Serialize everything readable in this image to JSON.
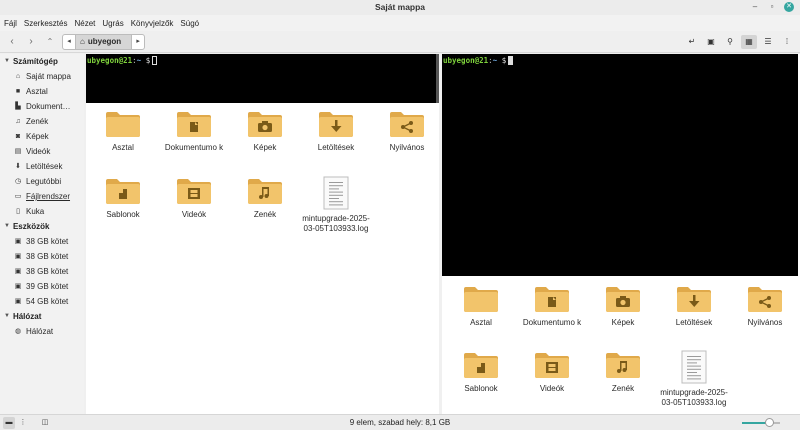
{
  "window": {
    "title": "Saját mappa"
  },
  "menu": [
    "Fájl",
    "Szerkesztés",
    "Nézet",
    "Ugrás",
    "Könyvjelzők",
    "Súgó"
  ],
  "pathbar": {
    "current": "ubyegon"
  },
  "sidebar": {
    "sections": [
      {
        "title": "Számítógép",
        "items": [
          {
            "label": "Saját mappa",
            "icon": "home-icon"
          },
          {
            "label": "Asztal",
            "icon": "desktop-icon"
          },
          {
            "label": "Dokument…",
            "icon": "document-icon"
          },
          {
            "label": "Zenék",
            "icon": "music-icon"
          },
          {
            "label": "Képek",
            "icon": "camera-icon"
          },
          {
            "label": "Videók",
            "icon": "film-icon"
          },
          {
            "label": "Letöltések",
            "icon": "download-icon"
          },
          {
            "label": "Legutóbbi",
            "icon": "clock-icon"
          },
          {
            "label": "Fájlrendszer",
            "icon": "drive-icon"
          },
          {
            "label": "Kuka",
            "icon": "trash-icon"
          }
        ]
      },
      {
        "title": "Eszközök",
        "items": [
          {
            "label": "38 GB kötet",
            "icon": "disk-icon"
          },
          {
            "label": "38 GB kötet",
            "icon": "disk-icon"
          },
          {
            "label": "38 GB kötet",
            "icon": "disk-icon"
          },
          {
            "label": "39 GB kötet",
            "icon": "disk-icon"
          },
          {
            "label": "54 GB kötet",
            "icon": "disk-icon"
          }
        ]
      },
      {
        "title": "Hálózat",
        "items": [
          {
            "label": "Hálózat",
            "icon": "network-icon"
          }
        ]
      }
    ]
  },
  "terminal": {
    "user": "ubyegon@21",
    "colon": ":",
    "path": "~",
    "prompt": "$"
  },
  "files": [
    {
      "name": "Asztal",
      "type": "folder",
      "emblem": ""
    },
    {
      "name": "Dokumentumo k",
      "type": "folder",
      "emblem": "document-icon"
    },
    {
      "name": "Képek",
      "type": "folder",
      "emblem": "camera-icon"
    },
    {
      "name": "Letöltések",
      "type": "folder",
      "emblem": "download-icon"
    },
    {
      "name": "Nyilvános",
      "type": "folder",
      "emblem": "share-icon"
    },
    {
      "name": "Sablonok",
      "type": "folder",
      "emblem": "template-icon"
    },
    {
      "name": "Videók",
      "type": "folder",
      "emblem": "film-icon"
    },
    {
      "name": "Zenék",
      "type": "folder",
      "emblem": "music-icon"
    },
    {
      "name": "mintupgrade-2025-03-05T103933.log",
      "type": "file",
      "emblem": ""
    }
  ],
  "status": {
    "text": "9 elem, szabad hely: 8,1 GB",
    "zoom_fraction": 0.72
  },
  "colors": {
    "accent": "#35a6a0",
    "folder": "#f2c46b",
    "terminal_user": "#7fd23c",
    "terminal_path": "#6fa8dc"
  }
}
